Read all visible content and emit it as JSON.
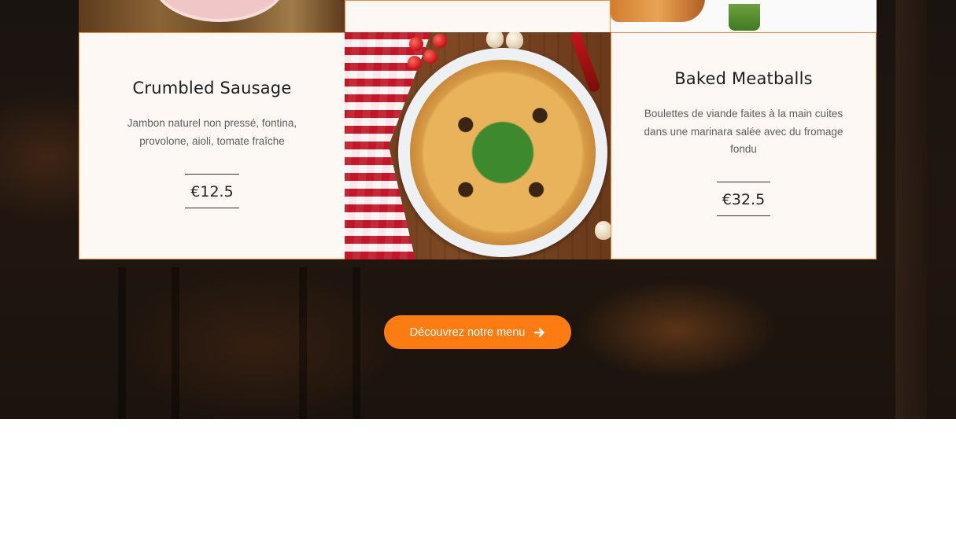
{
  "menu_items": [
    {
      "name": "Crumbled Sausage",
      "description": "Jambon naturel non pressé, fontina, provolone, aioli, tomate fraîche",
      "price": "€12.5"
    },
    {
      "name": "Baked Meatballs",
      "description": "Boulettes de viande faites à la main cuites dans une marinara salée avec du fromage fondu",
      "price": "€32.5"
    }
  ],
  "cta": {
    "label": "Découvrez notre menu",
    "icon": "arrow-right-icon"
  },
  "colors": {
    "accent": "#fd7c12",
    "card_border": "#f38d3a",
    "card_background": "#fdf8f3",
    "hero_background": "#1a1410"
  }
}
